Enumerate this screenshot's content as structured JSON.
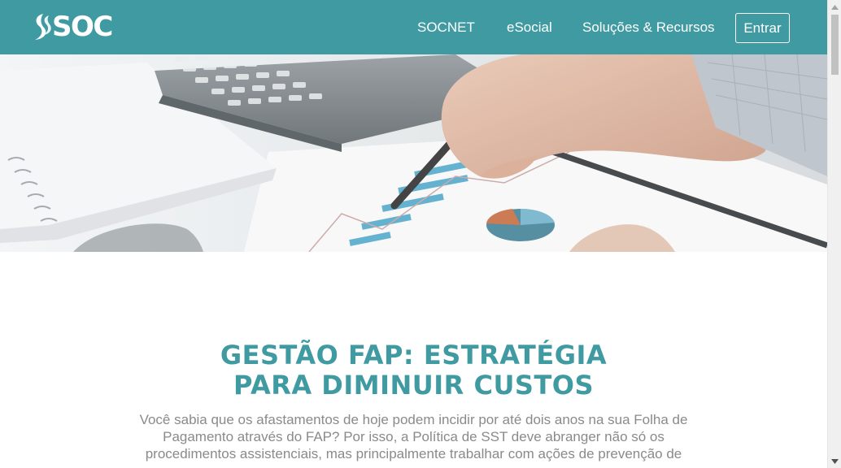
{
  "header": {
    "logo_text": "SOC",
    "nav": {
      "socnet": "SOCNET",
      "esocial": "eSocial",
      "solucoes": "Soluções & Recursos"
    },
    "login_label": "Entrar"
  },
  "hero": {
    "image": "business-charts-calculator-pen-photo"
  },
  "article": {
    "title_line1": "GESTÃO FAP: ESTRATÉGIA",
    "title_line2": "PARA DIMINUIR CUSTOS",
    "intro": "Você sabia que os afastamentos de hoje podem incidir por até dois anos na sua Folha de Pagamento através do FAP? Por isso, a Política de SST deve abranger não só os procedimentos assistenciais, mas principalmente trabalhar com ações de prevenção de"
  },
  "colors": {
    "brand": "#3f9aa1",
    "text_muted": "#8a8a8a"
  }
}
